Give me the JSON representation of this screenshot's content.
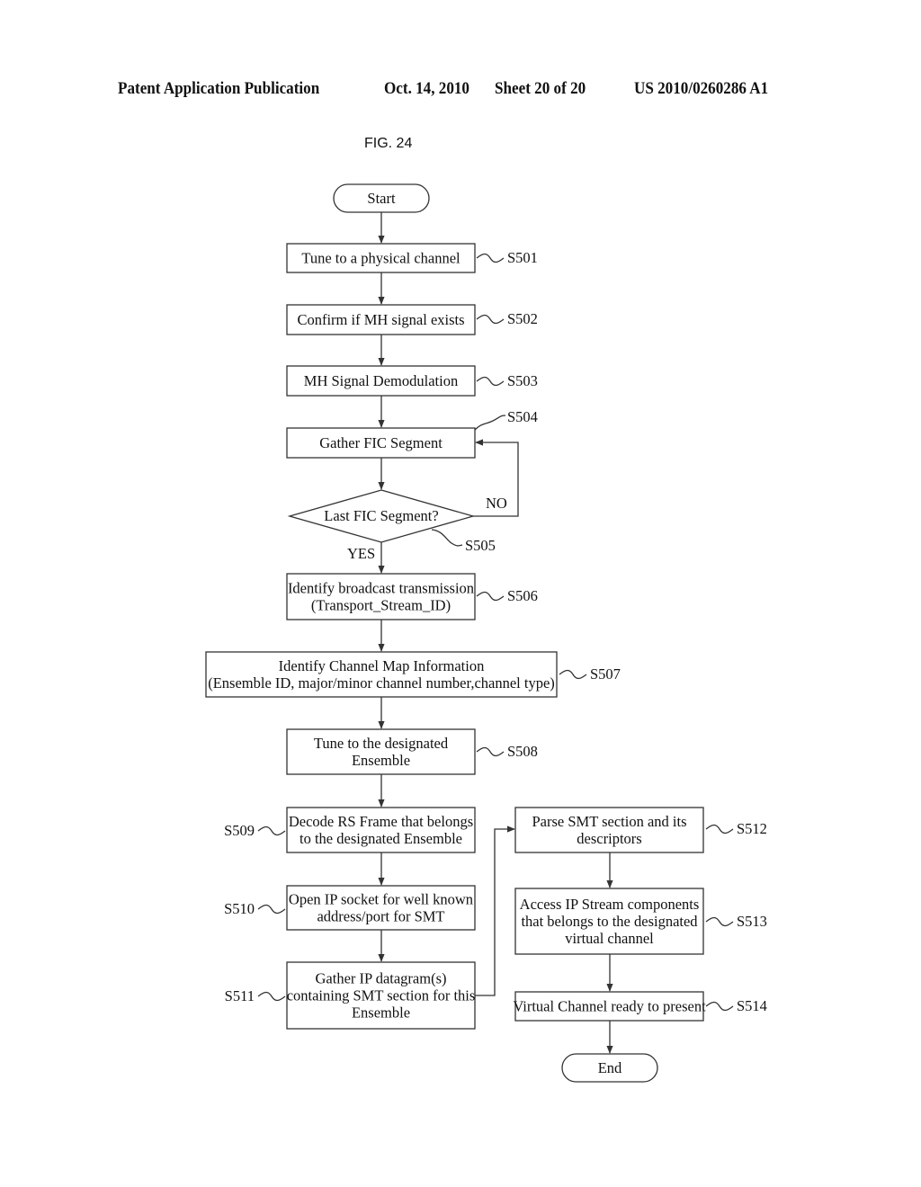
{
  "header": {
    "publication": "Patent Application Publication",
    "date": "Oct. 14, 2010",
    "sheet": "Sheet 20 of 20",
    "number": "US 2010/0260286 A1"
  },
  "figure": {
    "label": "FIG. 24"
  },
  "flowchart": {
    "start": "Start",
    "end": "End",
    "steps": [
      {
        "id": "S501",
        "lines": [
          "Tune to a physical channel"
        ]
      },
      {
        "id": "S502",
        "lines": [
          "Confirm if MH signal exists"
        ]
      },
      {
        "id": "S503",
        "lines": [
          "MH Signal Demodulation"
        ]
      },
      {
        "id": "S504",
        "lines": [
          "Gather FIC Segment"
        ]
      },
      {
        "id": "S505",
        "lines": [
          "Last FIC Segment?"
        ],
        "type": "decision",
        "yes": "YES",
        "no": "NO"
      },
      {
        "id": "S506",
        "lines": [
          "Identify broadcast transmission",
          "(Transport_Stream_ID)"
        ]
      },
      {
        "id": "S507",
        "lines": [
          "Identify Channel Map Information",
          "(Ensemble ID, major/minor channel number,channel type)"
        ]
      },
      {
        "id": "S508",
        "lines": [
          "Tune to the designated",
          "Ensemble"
        ]
      },
      {
        "id": "S509",
        "lines": [
          "Decode RS Frame that belongs",
          "to the designated Ensemble"
        ]
      },
      {
        "id": "S510",
        "lines": [
          "Open IP socket for well known",
          "address/port for SMT"
        ]
      },
      {
        "id": "S511",
        "lines": [
          "Gather IP datagram(s)",
          "containing SMT section for this",
          "Ensemble"
        ]
      },
      {
        "id": "S512",
        "lines": [
          "Parse SMT section and its",
          "descriptors"
        ]
      },
      {
        "id": "S513",
        "lines": [
          "Access IP Stream components",
          "that belongs to the designated",
          "virtual channel"
        ]
      },
      {
        "id": "S514",
        "lines": [
          "Virtual Channel ready to present"
        ]
      }
    ]
  }
}
